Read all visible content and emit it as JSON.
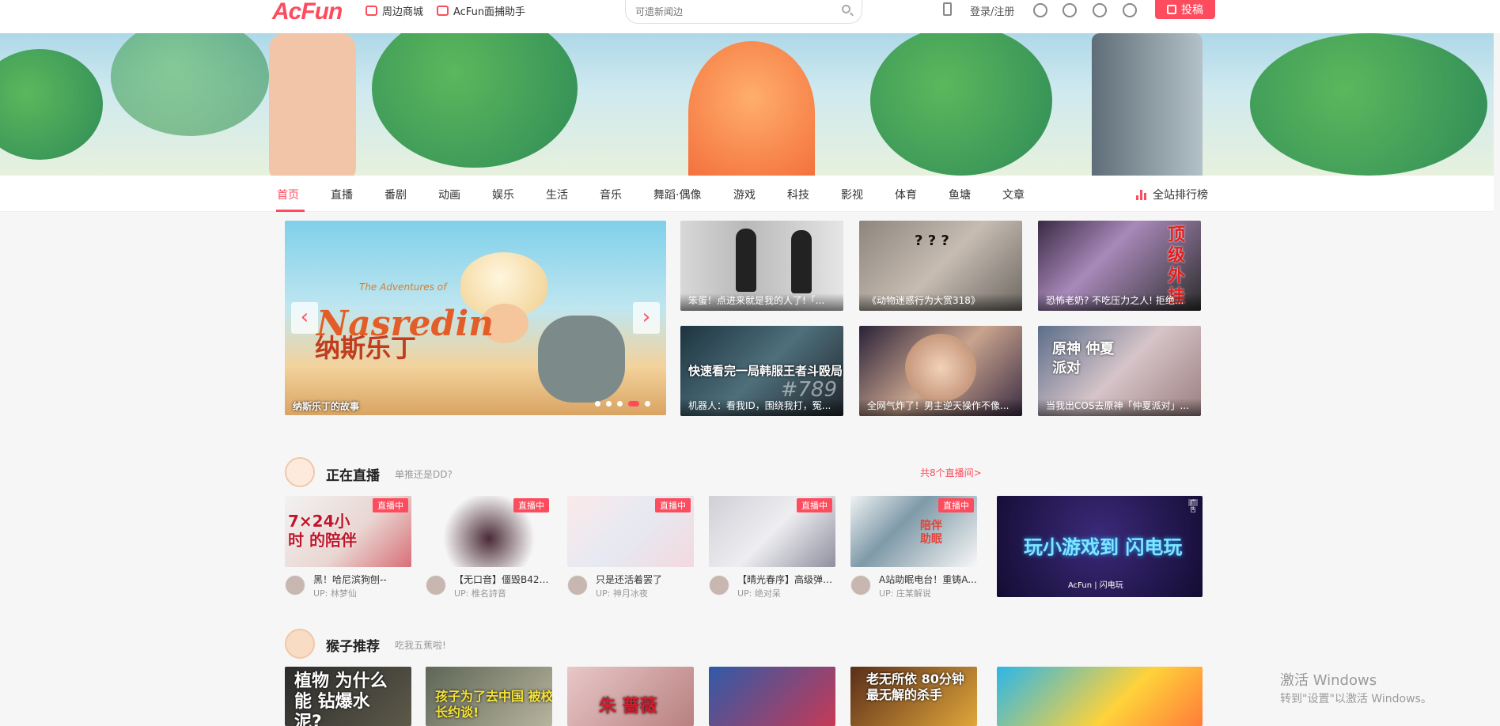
{
  "header": {
    "logo": "AcFun",
    "links": [
      "周边商城",
      "AcFun面捕助手"
    ],
    "search_placeholder": "可遗新闻边",
    "login": "登录/注册",
    "upload": "投稿"
  },
  "nav": {
    "items": [
      "首页",
      "直播",
      "番剧",
      "动画",
      "娱乐",
      "生活",
      "音乐",
      "舞蹈·偶像",
      "游戏",
      "科技",
      "影视",
      "体育",
      "鱼塘",
      "文章"
    ],
    "active": "首页",
    "rank": "全站排行榜"
  },
  "carousel": {
    "title_en": "Nasredin",
    "title_en_small": "The Adventures of",
    "title_cn": "纳斯乐丁",
    "caption": "纳斯乐丁的故事",
    "prev": "‹",
    "next": "›",
    "slide_count": 5,
    "active_slide": 4
  },
  "thumbs": [
    {
      "caption": "笨蛋！点进来就是我的人了!「..."
    },
    {
      "caption": "《动物迷惑行为大赏318》",
      "overlay": "? ? ?"
    },
    {
      "caption": "恐怖老奶? 不吃压力之人! 拒绝...",
      "side": "顶级外挂"
    },
    {
      "caption": "机器人：看我ID，围绕我打，冤...",
      "overlay": "快速看完一局韩服王者斗殴局",
      "num": "#789"
    },
    {
      "caption": "全网气炸了！男主逆天操作不像..."
    },
    {
      "caption": "当我出COS去原神「仲夏派对」...",
      "overlay": "原神 仲夏派对"
    }
  ],
  "live": {
    "title": "正在直播",
    "subtitle": "单推还是DD?",
    "more": "共8个直播间>",
    "badge": "直播中",
    "cards": [
      {
        "title": "黑！哈尼滨狗刨--",
        "up": "UP:  林梦仙",
        "overlay": "7×24小时 的陪伴"
      },
      {
        "title": "【无口音】僵毁B42股...",
        "up": "UP:  椎名詩音"
      },
      {
        "title": "只是还活着罢了",
        "up": "UP:  神月冰夜"
      },
      {
        "title": "【晴光春序】高级弹幕...",
        "up": "UP:  绝对呆"
      },
      {
        "title": "A站助眠电台！重铸A...",
        "up": "UP:  庄某解说",
        "overlay": "陪伴 助眠"
      }
    ],
    "ad": {
      "text": "玩小游戏到 闪电玩",
      "brand": "AcFun | 闪电玩",
      "tag": "广告"
    }
  },
  "monkey": {
    "title": "猴子推荐",
    "subtitle": "吃我五蕉啦!",
    "cards": [
      {
        "overlay": "植物 为什么能 钻爆水泥?"
      },
      {
        "overlay": "孩子为了去中国 被校长约谈!"
      },
      {
        "overlay": "朱 蔷薇"
      },
      {
        "overlay": ""
      },
      {
        "overlay": "老无所依 80分钟最无解的杀手"
      },
      {
        "overlay": ""
      }
    ]
  },
  "watermark": {
    "line1": "激活 Windows",
    "line2": "转到\"设置\"以激活 Windows。"
  },
  "colors": {
    "accent": "#fd4c5d"
  }
}
